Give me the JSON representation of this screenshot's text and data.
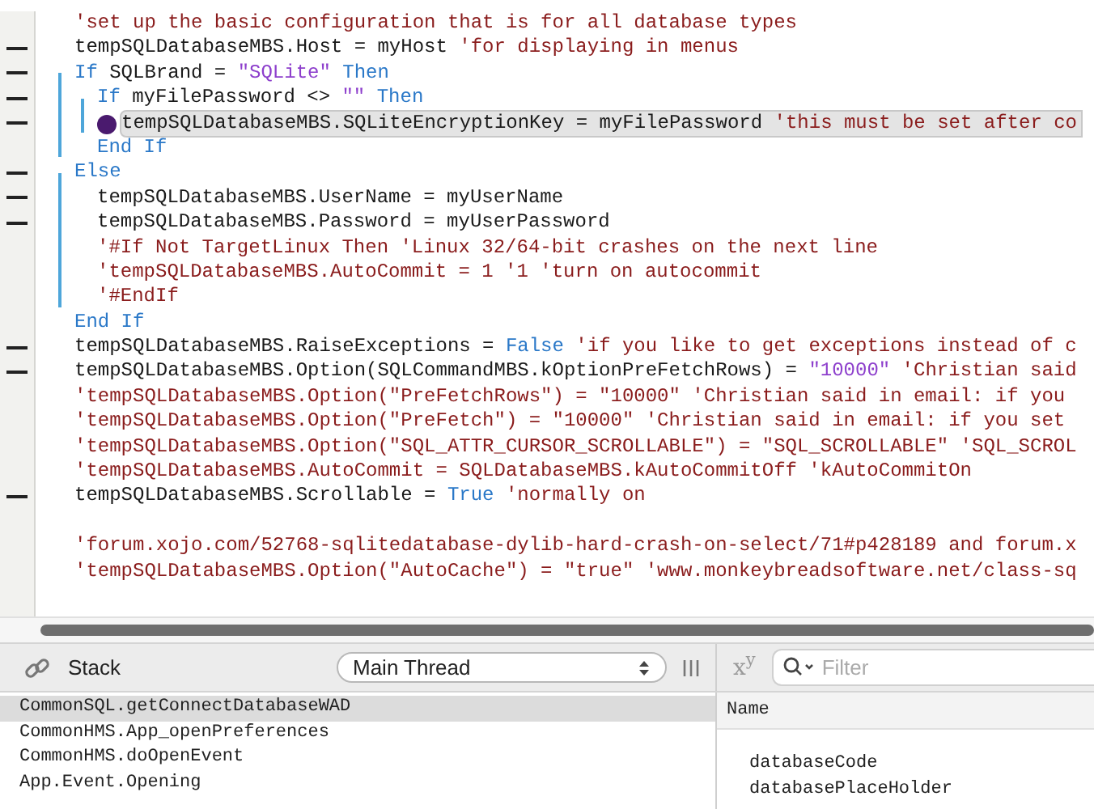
{
  "editor": {
    "lines": [
      {
        "kind": "code",
        "marker": false,
        "current": false,
        "segments": [
          {
            "kind": "comment",
            "text": "'set up the basic configuration that is for all database types"
          }
        ]
      },
      {
        "kind": "code",
        "marker": true,
        "current": false,
        "segments": [
          {
            "kind": "plain",
            "text": "tempSQLDatabaseMBS.Host = myHost "
          },
          {
            "kind": "comment",
            "text": "'for displaying in menus"
          }
        ]
      },
      {
        "kind": "code",
        "marker": true,
        "current": false,
        "segments": [
          {
            "kind": "keyword",
            "text": "If"
          },
          {
            "kind": "plain",
            "text": " SQLBrand = "
          },
          {
            "kind": "string",
            "text": "\"SQLite\""
          },
          {
            "kind": "keyword",
            "text": " Then"
          }
        ],
        "children": [
          {
            "kind": "code",
            "marker": true,
            "current": false,
            "segments": [
              {
                "kind": "keyword",
                "text": "If"
              },
              {
                "kind": "plain",
                "text": " myFilePassword <> "
              },
              {
                "kind": "string",
                "text": "\"\""
              },
              {
                "kind": "keyword",
                "text": " Then"
              }
            ],
            "children": [
              {
                "kind": "code",
                "marker": true,
                "current": true,
                "segments": [
                  {
                    "kind": "plain",
                    "text": "tempSQLDatabaseMBS.SQLiteEncryptionKey = myFilePassword "
                  },
                  {
                    "kind": "comment",
                    "text": "'this must be set after co"
                  }
                ]
              }
            ]
          },
          {
            "kind": "code",
            "marker": false,
            "current": false,
            "segments": [
              {
                "kind": "keyword",
                "text": "End If"
              }
            ]
          }
        ]
      },
      {
        "kind": "code",
        "marker": true,
        "current": false,
        "segments": [
          {
            "kind": "keyword",
            "text": "Else"
          }
        ],
        "children": [
          {
            "kind": "code",
            "marker": true,
            "current": false,
            "segments": [
              {
                "kind": "plain",
                "text": "tempSQLDatabaseMBS.UserName = myUserName"
              }
            ]
          },
          {
            "kind": "code",
            "marker": true,
            "current": false,
            "segments": [
              {
                "kind": "plain",
                "text": "tempSQLDatabaseMBS.Password = myUserPassword"
              }
            ]
          },
          {
            "kind": "code",
            "marker": false,
            "current": false,
            "segments": [
              {
                "kind": "comment",
                "text": "'#If Not TargetLinux Then 'Linux 32/64-bit crashes on the next line"
              }
            ]
          },
          {
            "kind": "code",
            "marker": false,
            "current": false,
            "segments": [
              {
                "kind": "comment",
                "text": "'tempSQLDatabaseMBS.AutoCommit = 1 '1 'turn on autocommit"
              }
            ]
          },
          {
            "kind": "code",
            "marker": false,
            "current": false,
            "segments": [
              {
                "kind": "comment",
                "text": "'#EndIf"
              }
            ]
          }
        ]
      },
      {
        "kind": "code",
        "marker": false,
        "current": false,
        "segments": [
          {
            "kind": "keyword",
            "text": "End If"
          }
        ]
      },
      {
        "kind": "code",
        "marker": true,
        "current": false,
        "segments": [
          {
            "kind": "plain",
            "text": "tempSQLDatabaseMBS.RaiseExceptions = "
          },
          {
            "kind": "keyword",
            "text": "False"
          },
          {
            "kind": "comment",
            "text": " 'if you like to get exceptions instead of c"
          }
        ]
      },
      {
        "kind": "code",
        "marker": true,
        "current": false,
        "segments": [
          {
            "kind": "plain",
            "text": "tempSQLDatabaseMBS.Option(SQLCommandMBS.kOptionPreFetchRows) = "
          },
          {
            "kind": "string",
            "text": "\"10000\""
          },
          {
            "kind": "comment",
            "text": " 'Christian said"
          }
        ]
      },
      {
        "kind": "code",
        "marker": false,
        "current": false,
        "segments": [
          {
            "kind": "comment",
            "text": "'tempSQLDatabaseMBS.Option(\"PreFetchRows\") = \"10000\" 'Christian said in email: if you"
          }
        ]
      },
      {
        "kind": "code",
        "marker": false,
        "current": false,
        "segments": [
          {
            "kind": "comment",
            "text": "'tempSQLDatabaseMBS.Option(\"PreFetch\") = \"10000\" 'Christian said in email: if you set"
          }
        ]
      },
      {
        "kind": "code",
        "marker": false,
        "current": false,
        "segments": [
          {
            "kind": "comment",
            "text": "'tempSQLDatabaseMBS.Option(\"SQL_ATTR_CURSOR_SCROLLABLE\") = \"SQL_SCROLLABLE\" 'SQL_SCROL"
          }
        ]
      },
      {
        "kind": "code",
        "marker": false,
        "current": false,
        "segments": [
          {
            "kind": "comment",
            "text": "'tempSQLDatabaseMBS.AutoCommit = SQLDatabaseMBS.kAutoCommitOff 'kAutoCommitOn"
          }
        ]
      },
      {
        "kind": "code",
        "marker": true,
        "current": false,
        "segments": [
          {
            "kind": "plain",
            "text": "tempSQLDatabaseMBS.Scrollable = "
          },
          {
            "kind": "keyword",
            "text": "True"
          },
          {
            "kind": "comment",
            "text": " 'normally on"
          }
        ]
      },
      {
        "kind": "blank",
        "marker": false
      },
      {
        "kind": "code",
        "marker": false,
        "current": false,
        "segments": [
          {
            "kind": "comment",
            "text": "'forum.xojo.com/52768-sqlitedatabase-dylib-hard-crash-on-select/71#p428189 and forum.x"
          }
        ]
      },
      {
        "kind": "code",
        "marker": false,
        "current": false,
        "segments": [
          {
            "kind": "comment",
            "text": "'tempSQLDatabaseMBS.Option(\"AutoCache\") = \"true\" 'www.monkeybreadsoftware.net/class-sq"
          }
        ]
      }
    ]
  },
  "debugger": {
    "stack_title": "Stack",
    "thread": "Main Thread",
    "filter_placeholder": "Filter",
    "format_toggle": "x$^{y}$",
    "stack": [
      {
        "text": "CommonSQL.getConnectDatabaseWAD",
        "selected": true
      },
      {
        "text": "CommonHMS.App_openPreferences",
        "selected": false
      },
      {
        "text": "CommonHMS.doOpenEvent",
        "selected": false
      },
      {
        "text": "App.Event.Opening",
        "selected": false
      }
    ],
    "variables": {
      "columns": [
        "Name"
      ],
      "rows": [
        "databaseCode",
        "databasePlaceHolder"
      ]
    }
  }
}
